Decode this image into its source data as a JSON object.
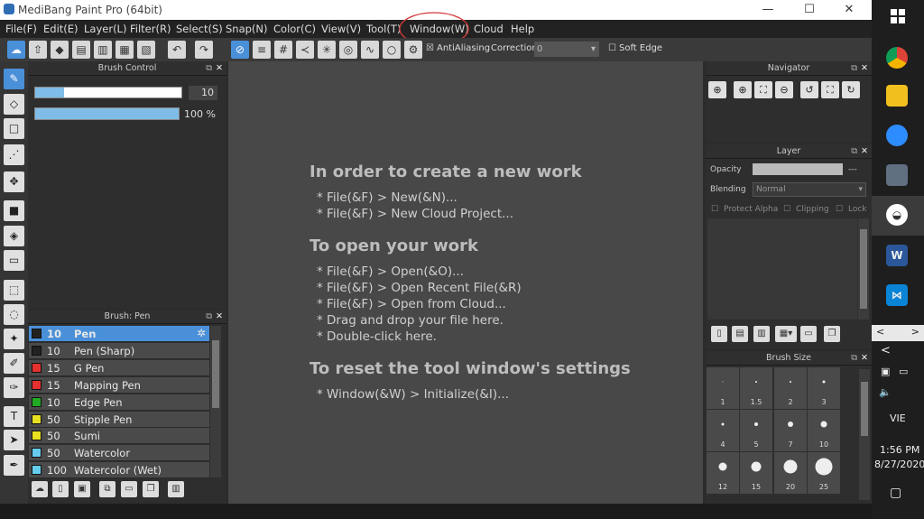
{
  "app": {
    "title": "MediBang Paint Pro (64bit)",
    "minimize": "—",
    "maximize": "☐",
    "close": "✕"
  },
  "menu": [
    "File(F)",
    "Edit(E)",
    "Layer(L)",
    "Filter(R)",
    "Select(S)",
    "Snap(N)",
    "Color(C)",
    "View(V)",
    "Tool(T)",
    "Window(W)",
    "Cloud",
    "Help"
  ],
  "toolbar": {
    "antialiasing": "AntiAliasing",
    "correction_label": "Correction",
    "correction_value": "0",
    "soft_edge": "Soft Edge"
  },
  "brush_control": {
    "title": "Brush Control",
    "size": "10",
    "opacity": "100 %",
    "size_fraction": 0.2,
    "opacity_fraction": 1.0
  },
  "brush_panel": {
    "title": "Brush: Pen",
    "items": [
      {
        "size": "10",
        "name": "Pen",
        "color": "#222222"
      },
      {
        "size": "10",
        "name": "Pen (Sharp)",
        "color": "#222222"
      },
      {
        "size": "15",
        "name": "G Pen",
        "color": "#e53030"
      },
      {
        "size": "15",
        "name": "Mapping Pen",
        "color": "#e53030"
      },
      {
        "size": "10",
        "name": "Edge Pen",
        "color": "#22aa22"
      },
      {
        "size": "50",
        "name": "Stipple Pen",
        "color": "#e8e020"
      },
      {
        "size": "50",
        "name": "Sumi",
        "color": "#e8e020"
      },
      {
        "size": "50",
        "name": "Watercolor",
        "color": "#66ccee"
      },
      {
        "size": "100",
        "name": "Watercolor (Wet)",
        "color": "#66ccee"
      }
    ]
  },
  "canvas": {
    "h1": "In order to create a new work",
    "l1": "* File(&F) > New(&N)...",
    "l2": "* File(&F) > New Cloud Project...",
    "h2": "To open your work",
    "l3": "* File(&F) > Open(&O)...",
    "l4": "* File(&F) > Open Recent File(&R)",
    "l5": "* File(&F) > Open from Cloud...",
    "l6": "* Drag and drop your file here.",
    "l7": "* Double-click here.",
    "h3": "To reset the tool window's settings",
    "l8": "* Window(&W) > Initialize(&I)..."
  },
  "navigator": {
    "title": "Navigator"
  },
  "layer": {
    "title": "Layer",
    "opacity_label": "Opacity",
    "opacity_value": "---",
    "blending_label": "Blending",
    "blending_value": "Normal",
    "protect_alpha": "Protect Alpha",
    "clipping": "Clipping",
    "lock": "Lock"
  },
  "brush_size": {
    "title": "Brush Size",
    "sizes": [
      "1",
      "1.5",
      "2",
      "3",
      "4",
      "5",
      "7",
      "10",
      "12",
      "15",
      "20",
      "25"
    ]
  },
  "taskbar": {
    "time": "1:56 PM",
    "date": "8/27/2020",
    "lang": "VIE",
    "prev": "<",
    "next": ">",
    "collapse": "<"
  },
  "colors": {
    "accent": "#4a90d9",
    "annotation": "#d43a3a"
  }
}
